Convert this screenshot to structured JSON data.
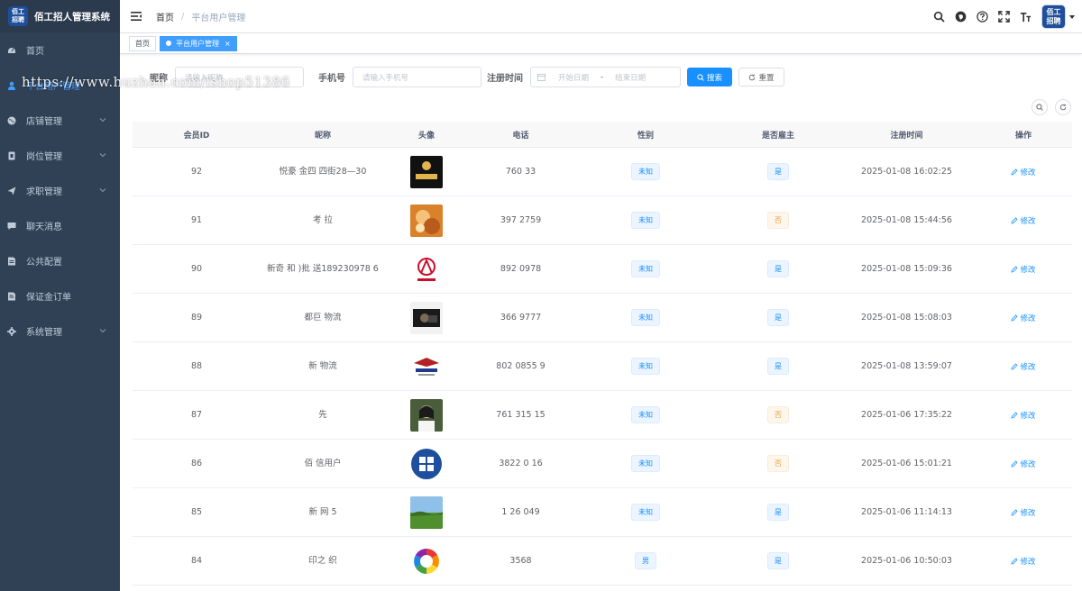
{
  "app": {
    "logo_text": "佰工招聘",
    "title": "佰工招人管理系统"
  },
  "sidebar": {
    "items": [
      {
        "label": "首页",
        "icon": "dashboard-icon",
        "active": false,
        "has_arrow": false
      },
      {
        "label": "平台用户管理",
        "icon": "user-icon",
        "active": true,
        "has_arrow": false
      },
      {
        "label": "店铺管理",
        "icon": "globe-icon",
        "active": false,
        "has_arrow": true
      },
      {
        "label": "岗位管理",
        "icon": "job-icon",
        "active": false,
        "has_arrow": true
      },
      {
        "label": "求职管理",
        "icon": "send-icon",
        "active": false,
        "has_arrow": true
      },
      {
        "label": "聊天消息",
        "icon": "message-icon",
        "active": false,
        "has_arrow": false
      },
      {
        "label": "公共配置",
        "icon": "config-icon",
        "active": false,
        "has_arrow": false
      },
      {
        "label": "保证金订单",
        "icon": "order-icon",
        "active": false,
        "has_arrow": false
      },
      {
        "label": "系统管理",
        "icon": "gear-icon",
        "active": false,
        "has_arrow": true
      }
    ]
  },
  "navbar": {
    "breadcrumb": [
      "首页",
      "平台用户管理"
    ],
    "avatar_text": "佰工招聘"
  },
  "tags": [
    {
      "label": "首页",
      "active": false
    },
    {
      "label": "平台用户管理",
      "active": true
    }
  ],
  "search": {
    "nickname_label": "昵称",
    "nickname_placeholder": "请输入昵称",
    "phone_label": "手机号",
    "phone_placeholder": "请输入手机号",
    "regtime_label": "注册时间",
    "start_placeholder": "开始日期",
    "range_sep": "-",
    "end_placeholder": "结束日期",
    "search_btn": "搜索",
    "reset_btn": "重置"
  },
  "watermark": "https://www.huzhan.com/ishop51386",
  "table": {
    "columns": [
      "会员ID",
      "昵称",
      "头像",
      "电话",
      "性别",
      "是否雇主",
      "注册时间",
      "操作"
    ],
    "edit_label": "修改",
    "rows": [
      {
        "id": "92",
        "nick": "悦豪 金四 四街28—30",
        "phone": "760 33",
        "gender": "未知",
        "employer": "是",
        "employer_type": "info",
        "time": "2025-01-08 16:02:25",
        "avatar": "avatar-92"
      },
      {
        "id": "91",
        "nick": "考 拉",
        "phone": "397 2759",
        "gender": "未知",
        "employer": "否",
        "employer_type": "warn",
        "time": "2025-01-08 15:44:56",
        "avatar": "avatar-91"
      },
      {
        "id": "90",
        "nick": "新奇 和 )批 送189230978 6",
        "phone": "892 0978",
        "gender": "未知",
        "employer": "是",
        "employer_type": "info",
        "time": "2025-01-08 15:09:36",
        "avatar": "avatar-90"
      },
      {
        "id": "89",
        "nick": "都巨 物流",
        "phone": "366 9777",
        "gender": "未知",
        "employer": "是",
        "employer_type": "info",
        "time": "2025-01-08 15:08:03",
        "avatar": "avatar-89"
      },
      {
        "id": "88",
        "nick": "新 物流",
        "phone": "802 0855 9",
        "gender": "未知",
        "employer": "是",
        "employer_type": "info",
        "time": "2025-01-08 13:59:07",
        "avatar": "avatar-88"
      },
      {
        "id": "87",
        "nick": "先",
        "phone": "761 315 15",
        "gender": "未知",
        "employer": "否",
        "employer_type": "warn",
        "time": "2025-01-06 17:35:22",
        "avatar": "avatar-87"
      },
      {
        "id": "86",
        "nick": "佰 信用户",
        "phone": "3822 0 16",
        "gender": "未知",
        "employer": "否",
        "employer_type": "warn",
        "time": "2025-01-06 15:01:21",
        "avatar": "avatar-86"
      },
      {
        "id": "85",
        "nick": "新 网 5",
        "phone": "1 26 049",
        "gender": "未知",
        "employer": "是",
        "employer_type": "info",
        "time": "2025-01-06 11:14:13",
        "avatar": "avatar-85"
      },
      {
        "id": "84",
        "nick": "印之 织",
        "phone": "3568",
        "gender": "男",
        "employer": "是",
        "employer_type": "info",
        "time": "2025-01-06 10:50:03",
        "avatar": "avatar-84"
      }
    ]
  },
  "colors": {
    "sidebar_bg": "#304156",
    "primary": "#1890ff",
    "active_menu": "#409eff",
    "warn": "#e6a23c"
  }
}
